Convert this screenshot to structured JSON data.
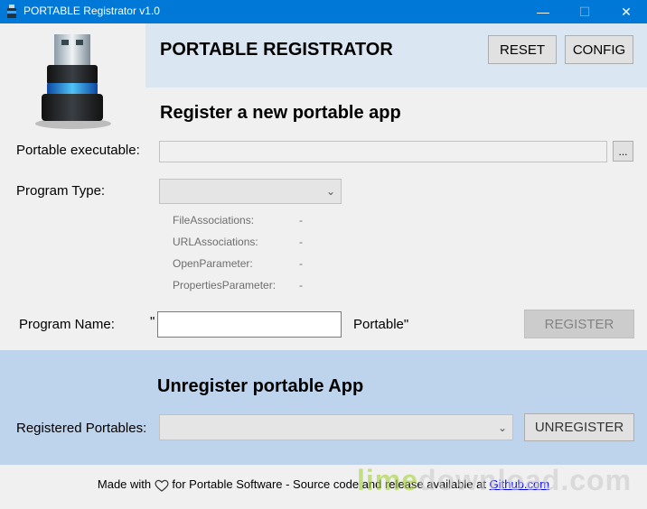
{
  "window": {
    "title": "PORTABLE Registrator v1.0",
    "min_glyph": "—",
    "max_glyph": "☐",
    "close_glyph": "✕"
  },
  "header": {
    "heading": "PORTABLE REGISTRATOR",
    "reset_label": "RESET",
    "config_label": "CONFIG"
  },
  "register": {
    "title": "Register a new portable app",
    "executable_label": "Portable executable:",
    "executable_value": "",
    "browse_label": "...",
    "program_type_label": "Program Type:",
    "program_type_value": "",
    "info": [
      {
        "name": "FileAssociations:",
        "value": "-"
      },
      {
        "name": "URLAssociations:",
        "value": "-"
      },
      {
        "name": "OpenParameter:",
        "value": "-"
      },
      {
        "name": "PropertiesParameter:",
        "value": "-"
      }
    ],
    "program_name_label": "Program Name:",
    "quote_open": "\"",
    "program_name_value": "",
    "suffix": "Portable\"",
    "register_button": "REGISTER"
  },
  "unregister": {
    "title": "Unregister portable App",
    "registered_label": "Registered Portables:",
    "registered_value": "",
    "unregister_button": "UNREGISTER"
  },
  "footer": {
    "prefix": "Made with",
    "middle": "for Portable Software - Source code and release available at",
    "link_text": "Github.com"
  },
  "watermark": {
    "part1": "lime",
    "part2": "download.com"
  },
  "icons": {
    "app": "usb-drive-icon",
    "logo": "usb-drive-logo-icon",
    "heart": "heart-icon",
    "chevron": "chevron-down-icon"
  },
  "colors": {
    "titlebar": "#0078d7",
    "header_band": "#dae7f3",
    "unregister_band": "#bed3ec",
    "link": "#0000ee"
  }
}
